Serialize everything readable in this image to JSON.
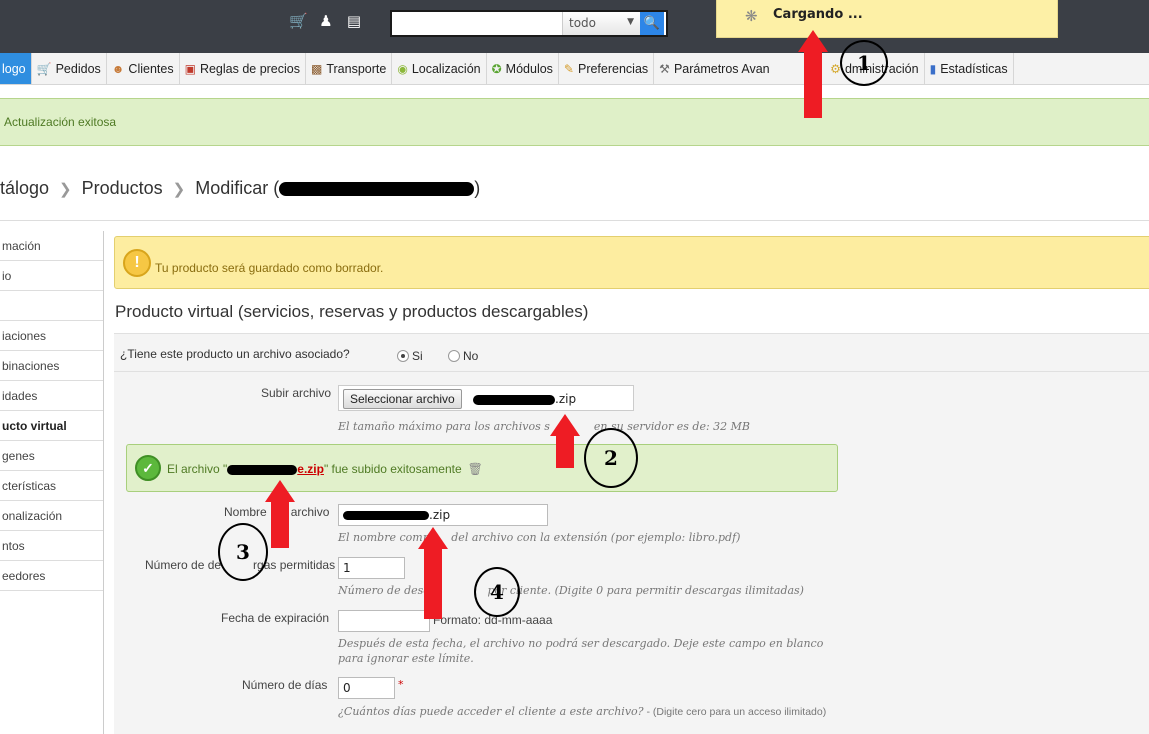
{
  "header": {
    "icons": [
      "cart-icon",
      "users-icon",
      "chat-icon"
    ],
    "search": {
      "value": "",
      "placeholder": "",
      "scope": "todo"
    },
    "loading_text": "Cargando ..."
  },
  "menu": {
    "items": [
      {
        "label": "logo",
        "icon": "catalog-icon",
        "active": true
      },
      {
        "label": "Pedidos",
        "icon": "cart-icon"
      },
      {
        "label": "Clientes",
        "icon": "user-icon"
      },
      {
        "label": "Reglas de precios",
        "icon": "price-rules-icon"
      },
      {
        "label": "Transporte",
        "icon": "truck-icon"
      },
      {
        "label": "Localización",
        "icon": "globe-icon"
      },
      {
        "label": "Módulos",
        "icon": "puzzle-icon"
      },
      {
        "label": "Preferencias",
        "icon": "preferences-icon"
      },
      {
        "label": "Parámetros Avan",
        "icon": "wrench-icon"
      },
      {
        "label": "dministración",
        "icon": "gear-icon"
      },
      {
        "label": "Estadísticas",
        "icon": "chart-icon"
      }
    ]
  },
  "success_message": "Actualización exitosa",
  "breadcrumb": {
    "part1": "tálogo",
    "part2": "Productos",
    "part3": "Modificar (",
    "part3_end": ")"
  },
  "sidebar": {
    "items": [
      {
        "label": "mación"
      },
      {
        "label": "io"
      },
      {
        "label": ""
      },
      {
        "label": "iaciones"
      },
      {
        "label": "binaciones"
      },
      {
        "label": "idades"
      },
      {
        "label": "ucto virtual",
        "active": true
      },
      {
        "label": "genes"
      },
      {
        "label": "cterísticas"
      },
      {
        "label": "onalización"
      },
      {
        "label": "ntos"
      },
      {
        "label": "eedores"
      }
    ]
  },
  "warning": "Tu producto será guardado como borrador.",
  "section_title": "Producto virtual (servicios, reservas y productos descargables)",
  "question": {
    "label": "¿Tiene este producto un archivo asociado?",
    "yes": "Si",
    "no": "No",
    "selected": "Si"
  },
  "upload": {
    "label": "Subir archivo",
    "button": "Seleccionar archivo",
    "filename_suffix": ".zip",
    "hint_a": "El tamaño máximo para los archivos s",
    "hint_b": "en su servidor es de: 32 MB"
  },
  "upload_ok": {
    "prefix": "El archivo \"",
    "link_suffix": "e.zip",
    "suffix": "\" fue subido exitosamente"
  },
  "filename": {
    "label_a": "Nombre",
    "label_b": "archivo",
    "value_suffix": ".zip",
    "hint_a": "El nombre compl",
    "hint_b": "del archivo con la extensión (por ejemplo: libro.pdf)"
  },
  "downloads": {
    "label_a": "Número de de",
    "label_b": "rgas permitidas",
    "value": "1",
    "hint_a": "Número de desc",
    "hint_b": "por cliente. (Digite 0 para permitir descargas ilimitadas)"
  },
  "expiration": {
    "label": "Fecha de expiración",
    "value": "",
    "format_label": "Formato: ",
    "format_value": "dd-mm-aaaa",
    "hint_line1": "Después de esta fecha, el archivo no podrá ser descargado. Deje este campo en blanco",
    "hint_line2": "para ignorar este límite."
  },
  "days": {
    "label": "Número de días",
    "value": "0",
    "required_mark": "*",
    "hint": "¿Cuántos días puede acceder el cliente a este archivo?",
    "hint_tail": " - (Digite cero para un acceso ilimitado)"
  },
  "annotations": {
    "n1": "1",
    "n2": "2",
    "n3": "3",
    "n4": "4",
    "arrow_color": "#ee1c24"
  }
}
